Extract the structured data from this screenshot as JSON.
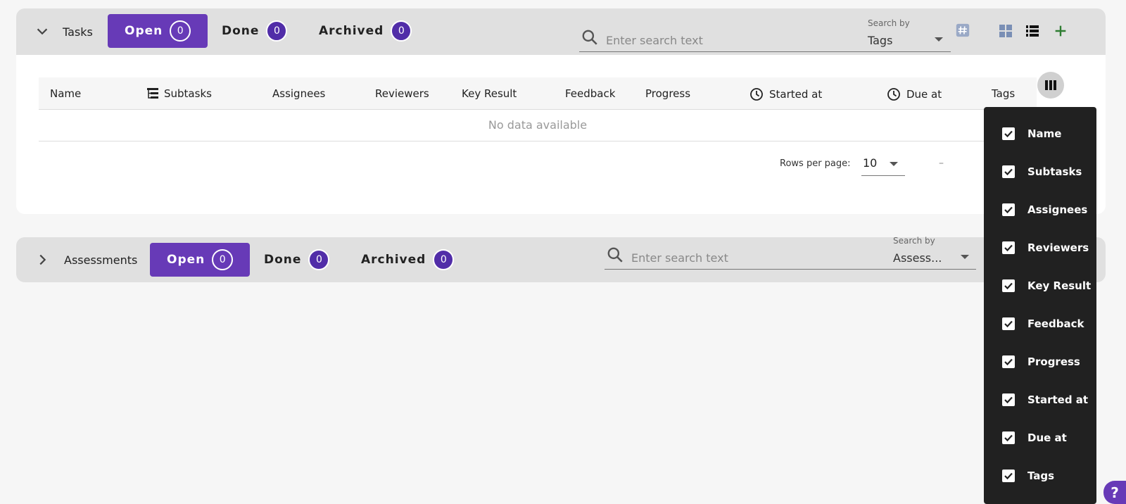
{
  "tasks": {
    "title": "Tasks",
    "tabs": [
      {
        "label": "Open",
        "count": "0"
      },
      {
        "label": "Done",
        "count": "0"
      },
      {
        "label": "Archived",
        "count": "0"
      }
    ],
    "search": {
      "placeholder": "Enter search text",
      "search_by_label": "Search by",
      "search_by_value": "Tags"
    },
    "table": {
      "columns": [
        "Name",
        "Subtasks",
        "Assignees",
        "Reviewers",
        "Key Result",
        "Feedback",
        "Progress",
        "Started at",
        "Due at",
        "Tags"
      ],
      "empty_text": "No data available"
    },
    "pagination": {
      "rows_per_page_label": "Rows per page:",
      "rows_per_page_value": "10",
      "range_text": "–"
    }
  },
  "assessments": {
    "title": "Assessments",
    "tabs": [
      {
        "label": "Open",
        "count": "0"
      },
      {
        "label": "Done",
        "count": "0"
      },
      {
        "label": "Archived",
        "count": "0"
      }
    ],
    "search": {
      "placeholder": "Enter search text",
      "search_by_label": "Search by",
      "search_by_value": "Assess..."
    }
  },
  "column_menu": {
    "items": [
      {
        "label": "Name",
        "checked": true
      },
      {
        "label": "Subtasks",
        "checked": true
      },
      {
        "label": "Assignees",
        "checked": true
      },
      {
        "label": "Reviewers",
        "checked": true
      },
      {
        "label": "Key Result",
        "checked": true
      },
      {
        "label": "Feedback",
        "checked": true
      },
      {
        "label": "Progress",
        "checked": true
      },
      {
        "label": "Started at",
        "checked": true
      },
      {
        "label": "Due at",
        "checked": true
      },
      {
        "label": "Tags",
        "checked": true
      }
    ]
  },
  "help": {
    "label": "?"
  },
  "colors": {
    "accent": "#673ab7",
    "accent_dark": "#512da8",
    "add": "#2e7d32",
    "menu_bg": "#212121"
  }
}
